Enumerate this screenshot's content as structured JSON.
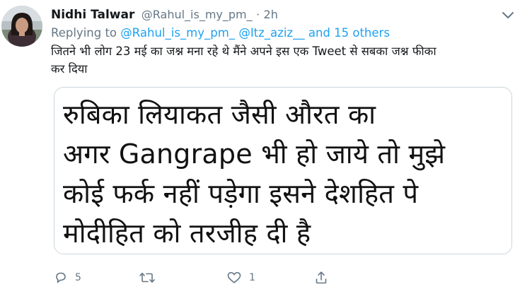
{
  "tweet": {
    "author_name": "Nidhi Talwar",
    "author_handle": "@Rahul_is_my_pm_",
    "separator": "·",
    "timestamp": "2h",
    "replying_prefix": "Replying to",
    "replying_mentions": [
      "@Rahul_is_my_pm_",
      "@Itz_aziz__"
    ],
    "replying_others": "and 15 others",
    "body_lines": [
      "जितने भी लोग 23 मई का जश्न मना रहे थे मैंने अपने इस एक Tweet से सबका जश्न फीका",
      "कर दिया"
    ],
    "media_text_lines": [
      "रुबिका लियाकत जैसी औरत का",
      "अगर Gangrape भी हो जाये तो मुझे",
      "कोई फर्क नहीं पड़ेगा इसने देशहित पे",
      "मोदीहित को तरजीह दी है"
    ],
    "actions": {
      "reply_count": "5",
      "retweet_count": "",
      "like_count": "1"
    },
    "icons": {
      "reply": "reply-icon",
      "retweet": "retweet-icon",
      "like": "heart-icon",
      "share": "share-icon",
      "menu": "chevron-down-icon"
    },
    "colors": {
      "link": "#1da1f2",
      "secondary_text": "#657786",
      "primary_text": "#14171a",
      "card_border": "#ccd6dd"
    }
  }
}
